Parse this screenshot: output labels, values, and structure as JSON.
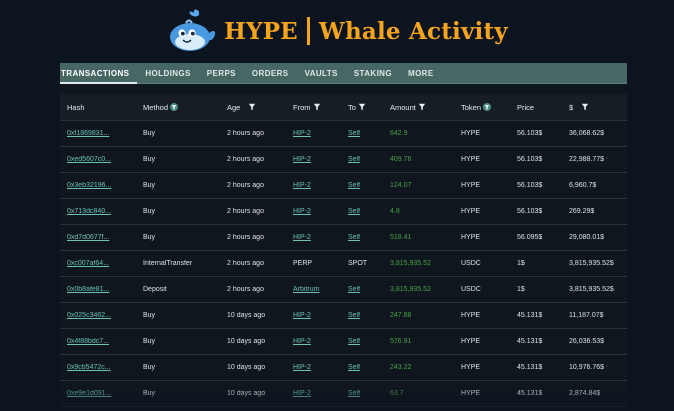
{
  "header": {
    "brand_left": "HYPE",
    "brand_right": "Whale Activity",
    "logo": "whale-icon"
  },
  "colors": {
    "brand_accent": "#f6a41d",
    "tab_bar": "#466763",
    "link": "#69c1b4",
    "amount": "#47a04a",
    "background": "#0c1420"
  },
  "tabs": [
    "TRANSACTIONS",
    "HOLDINGS",
    "PERPS",
    "ORDERS",
    "VAULTS",
    "STAKING",
    "MORE"
  ],
  "active_tab": "TRANSACTIONS",
  "table": {
    "columns": {
      "hash": "Hash",
      "method": "Method",
      "age": "Age",
      "from": "From",
      "to": "To",
      "amount": "Amount",
      "token": "Token",
      "price": "Price",
      "usd": "$"
    },
    "rows": [
      {
        "hash": "0xf1869831...",
        "method": "Buy",
        "age": "2 hours ago",
        "from": "HIP-2",
        "to": "Self",
        "amount": "642.9",
        "token": "HYPE",
        "price": "56.103$",
        "usd": "36,068.62$"
      },
      {
        "hash": "0xed5607c0...",
        "method": "Buy",
        "age": "2 hours ago",
        "from": "HIP-2",
        "to": "Self",
        "amount": "409.76",
        "token": "HYPE",
        "price": "56.103$",
        "usd": "22,988.77$"
      },
      {
        "hash": "0x3eb32196...",
        "method": "Buy",
        "age": "2 hours ago",
        "from": "HIP-2",
        "to": "Self",
        "amount": "124.07",
        "token": "HYPE",
        "price": "56.103$",
        "usd": "6,960.7$"
      },
      {
        "hash": "0x713dc840...",
        "method": "Buy",
        "age": "2 hours ago",
        "from": "HIP-2",
        "to": "Self",
        "amount": "4.8",
        "token": "HYPE",
        "price": "56.103$",
        "usd": "269.29$"
      },
      {
        "hash": "0xd7d0677f...",
        "method": "Buy",
        "age": "2 hours ago",
        "from": "HIP-2",
        "to": "Self",
        "amount": "518.41",
        "token": "HYPE",
        "price": "56.095$",
        "usd": "29,080.01$"
      },
      {
        "hash": "0xc007af64...",
        "method": "InternalTransfer",
        "age": "2 hours ago",
        "from": "PERP",
        "to": "SPOT",
        "amount": "3,815,935.52",
        "token": "USDC",
        "price": "1$",
        "usd": "3,815,935.52$"
      },
      {
        "hash": "0x0b8afe81...",
        "method": "Deposit",
        "age": "2 hours ago",
        "from": "Arbitrum",
        "to": "Self",
        "amount": "3,815,935.52",
        "token": "USDC",
        "price": "1$",
        "usd": "3,815,935.52$"
      },
      {
        "hash": "0x025c3462...",
        "method": "Buy",
        "age": "10 days ago",
        "from": "HIP-2",
        "to": "Self",
        "amount": "247.88",
        "token": "HYPE",
        "price": "45.131$",
        "usd": "11,187.07$"
      },
      {
        "hash": "0x4f88bdc7...",
        "method": "Buy",
        "age": "10 days ago",
        "from": "HIP-2",
        "to": "Self",
        "amount": "576.91",
        "token": "HYPE",
        "price": "45.131$",
        "usd": "26,036.53$"
      },
      {
        "hash": "0x9cb5472c...",
        "method": "Buy",
        "age": "10 days ago",
        "from": "HIP-2",
        "to": "Self",
        "amount": "243.22",
        "token": "HYPE",
        "price": "45.131$",
        "usd": "10,976.76$"
      },
      {
        "hash": "0xe9e1d091...",
        "method": "Buy",
        "age": "10 days ago",
        "from": "HIP-2",
        "to": "Self",
        "amount": "63.7",
        "token": "HYPE",
        "price": "45.131$",
        "usd": "2,874.84$"
      }
    ]
  }
}
